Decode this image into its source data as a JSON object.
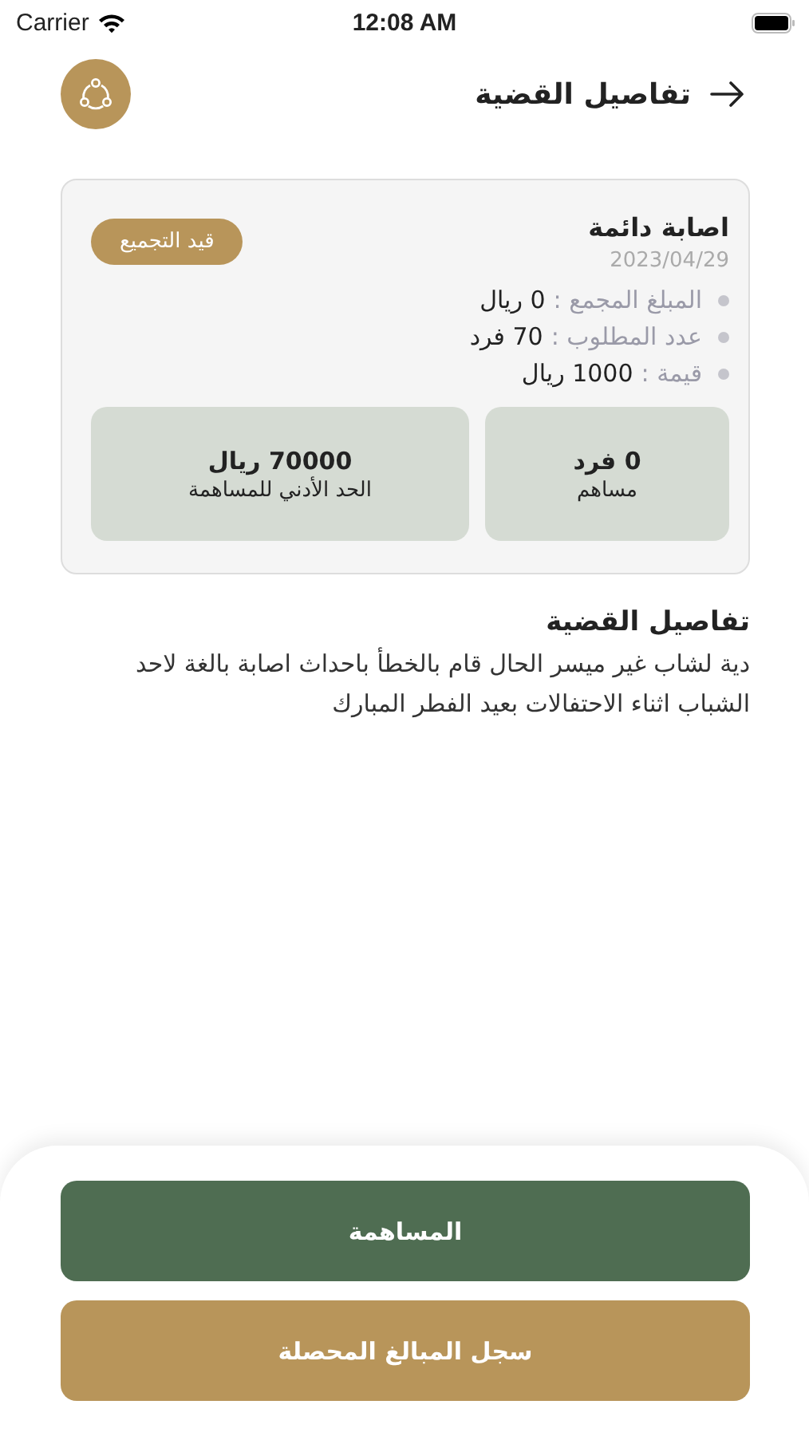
{
  "status_bar": {
    "carrier": "Carrier",
    "time": "12:08 AM"
  },
  "header": {
    "title": "تفاصيل القضية"
  },
  "case": {
    "title": "اصابة دائمة",
    "date": "2023/04/29",
    "status": "قيد التجميع",
    "details": [
      {
        "label": "المبلغ المجمع :",
        "value": "0 ريال"
      },
      {
        "label": "عدد المطلوب :",
        "value": "70 فرد"
      },
      {
        "label": "قيمة :",
        "value": "1000 ريال"
      }
    ],
    "stats": [
      {
        "value": "0 فرد",
        "label": "مساهم"
      },
      {
        "value": "70000 ريال",
        "label": "الحد الأدني للمساهمة"
      }
    ]
  },
  "description": {
    "title": "تفاصيل القضية",
    "text": "دية لشاب غير ميسر الحال قام بالخطأ باحداث اصابة بالغة لاحد الشباب اثناء الاحتفالات بعيد الفطر المبارك"
  },
  "buttons": [
    {
      "label": "المساهمة",
      "kind": "primary"
    },
    {
      "label": "سجل المبالغ المحصلة",
      "kind": "secondary"
    }
  ]
}
